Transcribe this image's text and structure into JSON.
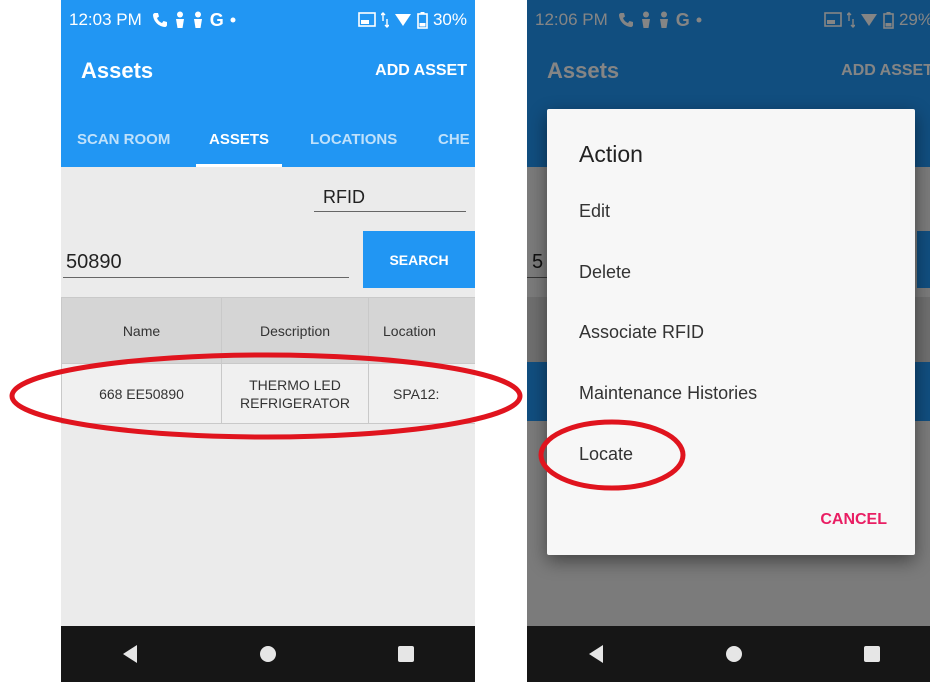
{
  "left_screen": {
    "status": {
      "time": "12:03 PM",
      "network": "G",
      "battery": "30%"
    },
    "app_title": "Assets",
    "add_asset_label": "ADD ASSET",
    "tabs": [
      "SCAN ROOM",
      "ASSETS",
      "LOCATIONS",
      "CHE"
    ],
    "active_tab": "ASSETS",
    "filter_type": "RFID",
    "search_value": "50890",
    "search_label": "SEARCH",
    "table": {
      "headers": [
        "Name",
        "Description",
        "Location"
      ],
      "rows": [
        [
          "668 EE50890",
          "THERMO LED REFRIGERATOR",
          "SPA12:"
        ]
      ]
    }
  },
  "right_screen": {
    "status": {
      "time": "12:06 PM",
      "network": "G",
      "battery": "29%"
    },
    "app_title": "Assets",
    "add_asset_label": "ADD ASSET",
    "search_value_partial": "5",
    "dialog": {
      "title": "Action",
      "items": [
        "Edit",
        "Delete",
        "Associate RFID",
        "Maintenance Histories",
        "Locate"
      ],
      "cancel_label": "CANCEL"
    }
  },
  "colors": {
    "primary": "#2196f3",
    "accent": "#e91e63",
    "annotation": "#e0141e",
    "navbar": "#161616"
  }
}
